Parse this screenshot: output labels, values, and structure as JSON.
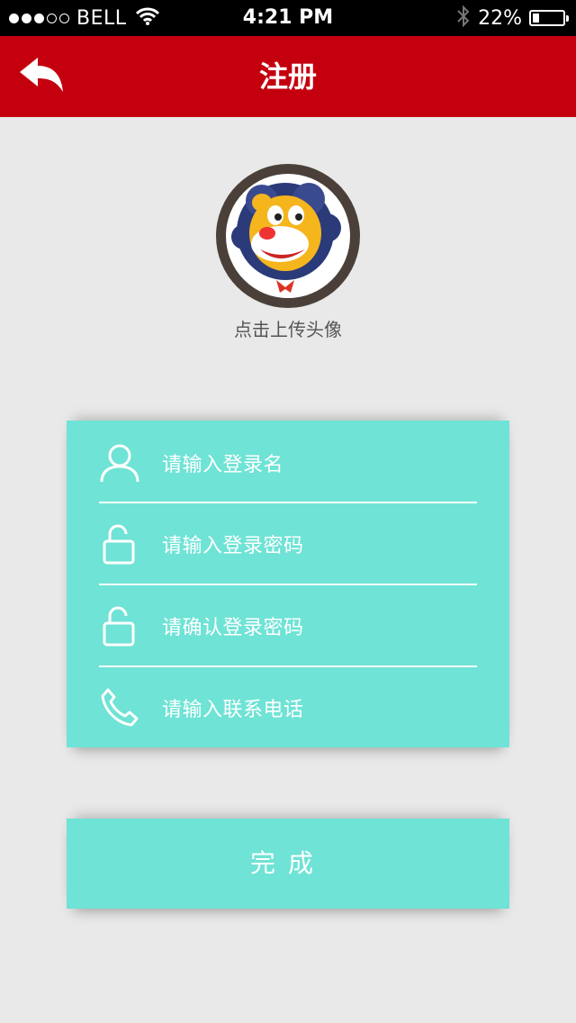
{
  "status_bar": {
    "carrier": "BELL",
    "time": "4:21 PM",
    "battery_percent": "22%",
    "battery_level": 0.22,
    "signal_dots_filled": 3,
    "signal_dots_total": 5,
    "icons": [
      "wifi-icon",
      "bluetooth-icon",
      "battery-icon"
    ]
  },
  "header": {
    "title": "注册",
    "back_icon": "back-arrow-icon",
    "color": "#c4000f"
  },
  "avatar": {
    "caption": "点击上传头像",
    "icon": "lion-mascot-avatar"
  },
  "form": {
    "accent": "#6fe3d5",
    "fields": [
      {
        "icon": "user-icon",
        "placeholder": "请输入登录名"
      },
      {
        "icon": "lock-icon",
        "placeholder": "请输入登录密码"
      },
      {
        "icon": "lock-icon",
        "placeholder": "请确认登录密码"
      },
      {
        "icon": "phone-icon",
        "placeholder": "请输入联系电话"
      }
    ]
  },
  "submit": {
    "label": "完成"
  }
}
